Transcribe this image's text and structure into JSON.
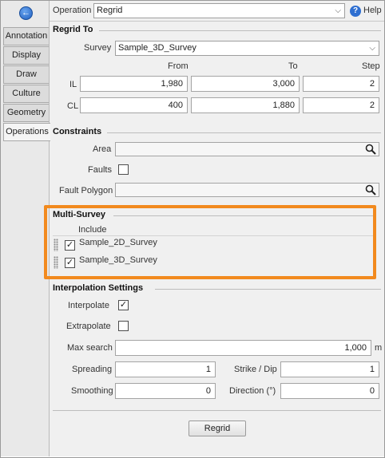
{
  "sidebar": {
    "back_icon": "back-arrow-icon",
    "tabs": [
      {
        "label": "Annotation"
      },
      {
        "label": "Display"
      },
      {
        "label": "Draw"
      },
      {
        "label": "Culture"
      },
      {
        "label": "Geometry"
      },
      {
        "label": "Operations",
        "active": true
      }
    ]
  },
  "header": {
    "operation_label": "Operation",
    "operation_value": "Regrid",
    "help_label": "Help"
  },
  "regrid_to": {
    "title": "Regrid To",
    "survey_label": "Survey",
    "survey_value": "Sample_3D_Survey",
    "col_from": "From",
    "col_to": "To",
    "col_step": "Step",
    "il_label": "IL",
    "il_from": "1,980",
    "il_to": "3,000",
    "il_step": "2",
    "cl_label": "CL",
    "cl_from": "400",
    "cl_to": "1,880",
    "cl_step": "2"
  },
  "constraints": {
    "title": "Constraints",
    "area_label": "Area",
    "area_value": "",
    "faults_label": "Faults",
    "faults_checked": false,
    "fault_polygon_label": "Fault Polygon",
    "fault_polygon_value": ""
  },
  "multi_survey": {
    "title": "Multi-Survey",
    "include_header": "Include",
    "rows": [
      {
        "label": "Sample_2D_Survey",
        "checked": true
      },
      {
        "label": "Sample_3D_Survey",
        "checked": true
      }
    ],
    "highlight_color": "#f28a1e"
  },
  "interpolation": {
    "title": "Interpolation Settings",
    "interpolate_label": "Interpolate",
    "interpolate_checked": true,
    "extrapolate_label": "Extrapolate",
    "extrapolate_checked": false,
    "max_search_label": "Max search",
    "max_search_value": "1,000",
    "max_search_unit": "m",
    "spreading_label": "Spreading",
    "spreading_value": "1",
    "strike_dip_label": "Strike / Dip",
    "strike_dip_value": "1",
    "smoothing_label": "Smoothing",
    "smoothing_value": "0",
    "direction_label": "Direction (°)",
    "direction_value": "0"
  },
  "actions": {
    "regrid_button": "Regrid"
  },
  "check_glyph": "✓"
}
